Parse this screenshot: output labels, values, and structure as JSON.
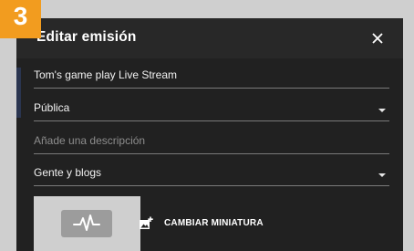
{
  "badge": {
    "step": "3"
  },
  "dialog": {
    "title": "Editar emisión",
    "close_icon": "close-icon"
  },
  "fields": {
    "title_value": "Tom's game play Live Stream",
    "privacy_value": "Pública",
    "description_placeholder": "Añade una descripción",
    "category_value": "Gente y blogs"
  },
  "thumbnail": {
    "icon": "activity-pulse-icon",
    "change_label": "CAMBIAR MINIATURA",
    "change_icon": "add-photo-icon"
  },
  "colors": {
    "badge_bg": "#f29c1f",
    "dialog_bg": "#212121",
    "header_bg": "#282828"
  }
}
